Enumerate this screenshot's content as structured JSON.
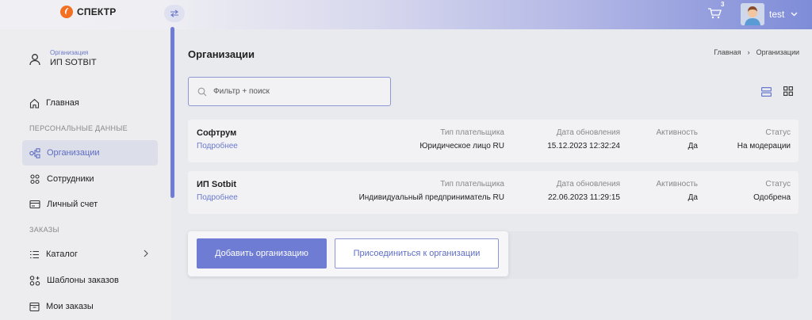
{
  "header": {
    "logo_text": "СПЕКТР",
    "cart_count": "3",
    "user_name": "test",
    "accent_color": "#6e7dd3",
    "logo_color": "#f36f21"
  },
  "sidebar": {
    "org_label": "Организация",
    "org_name": "ИП SOTBIT",
    "home": "Главная",
    "section_personal": "ПЕРСОНАЛЬНЫЕ ДАННЫЕ",
    "organizations": "Организации",
    "employees": "Сотрудники",
    "personal_account": "Личный счет",
    "section_orders": "ЗАКАЗЫ",
    "catalog": "Каталог",
    "order_templates": "Шаблоны заказов",
    "my_orders": "Мои заказы"
  },
  "main": {
    "title": "Организации",
    "breadcrumb": {
      "home": "Главная",
      "separator": "›",
      "current": "Организации"
    },
    "search_placeholder": "Фильтр + поиск",
    "columns": {
      "payer_type": "Тип плательщика",
      "updated": "Дата обновления",
      "activity": "Активность",
      "status": "Статус"
    },
    "organizations": [
      {
        "name": "Софтрум",
        "link": "Подробнее",
        "payer_type": "Юридическое лицо RU",
        "updated": "15.12.2023 12:32:24",
        "activity": "Да",
        "status": "На модерации"
      },
      {
        "name": "ИП Sotbit",
        "link": "Подробнее",
        "payer_type": "Индивидуальный предприниматель RU",
        "updated": "22.06.2023 11:29:15",
        "activity": "Да",
        "status": "Одобрена"
      }
    ],
    "add_button": "Добавить организацию",
    "join_button": "Присоединиться к организации"
  }
}
